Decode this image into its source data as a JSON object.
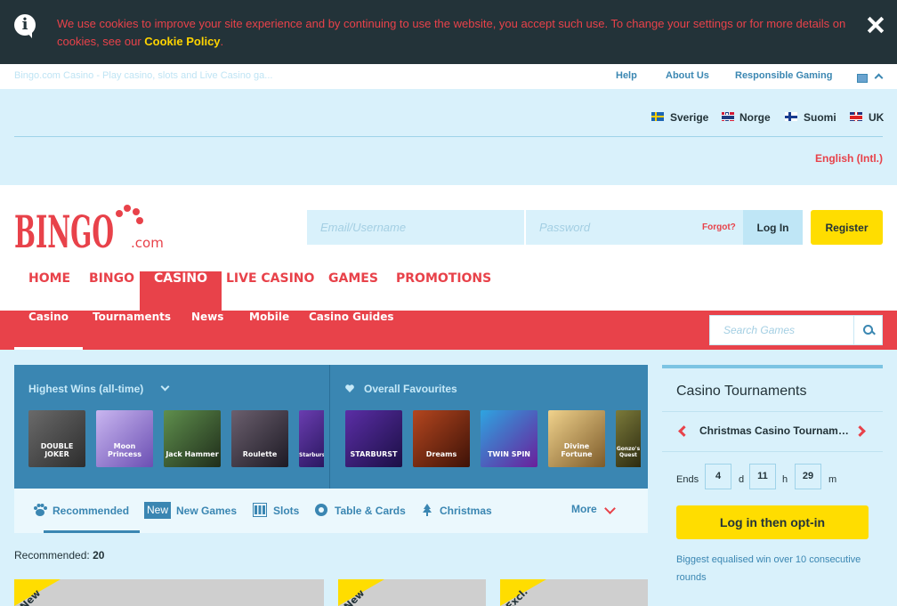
{
  "cookie_bar": {
    "message": "We use cookies to improve your site experience and by continuing to use the website, you accept such use. To change your settings or for more details on cookies, see our ",
    "link": "Cookie Policy",
    "period": "."
  },
  "top_bar": {
    "page_title": "Bingo.com Casino - Play casino, slots and Live Casino ga...",
    "links": [
      "Help",
      "About Us",
      "Responsible Gaming"
    ]
  },
  "languages": {
    "countries": [
      "Sverige",
      "Norge",
      "Suomi",
      "UK"
    ],
    "international": "English (Intl.)"
  },
  "header": {
    "logo_text": "BINGO",
    "logo_suffix": ".com",
    "email_placeholder": "Email/Username",
    "password_placeholder": "Password",
    "forgot": "Forgot?",
    "login": "Log In",
    "register": "Register"
  },
  "main_nav": [
    "HOME",
    "BINGO",
    "CASINO",
    "LIVE CASINO",
    "GAMES",
    "PROMOTIONS"
  ],
  "sub_nav": {
    "items": [
      "Casino",
      "Tournaments",
      "News",
      "Mobile",
      "Casino Guides"
    ],
    "search_placeholder": "Search Games"
  },
  "games_panel": {
    "left_title": "Highest Wins (all-time)",
    "right_title": "Overall Favourites",
    "left_games": [
      "DOUBLE JOKER",
      "Moon Princess",
      "Jack Hammer",
      "Roulette",
      "Starburst"
    ],
    "right_games": [
      "STARBURST",
      "Dreams",
      "TWIN SPIN",
      "Divine Fortune",
      "Gonzo's Quest"
    ]
  },
  "categories": {
    "recommended": "Recommended",
    "new_badge": "New",
    "new_games": "New Games",
    "slots": "Slots",
    "table_cards": "Table & Cards",
    "christmas": "Christmas",
    "more": "More"
  },
  "recommended": {
    "label": "Recommended:",
    "count": "20"
  },
  "cards": [
    "New",
    "New",
    "Excl."
  ],
  "tournaments": {
    "title": "Casino Tournaments",
    "name": "Christmas Casino Tournament",
    "ends_label": "Ends",
    "days": "4",
    "d": "d",
    "hours": "11",
    "h": "h",
    "minutes": "29",
    "m": "m",
    "button": "Log in then opt-in",
    "description": "Biggest equalised win over 10 consecutive rounds"
  },
  "colors": {
    "brand_red": "#e8424a",
    "accent_yellow": "#ffdd00",
    "panel_blue": "#3a86b2",
    "light_blue": "#d9f1fb",
    "dark": "#233339"
  }
}
